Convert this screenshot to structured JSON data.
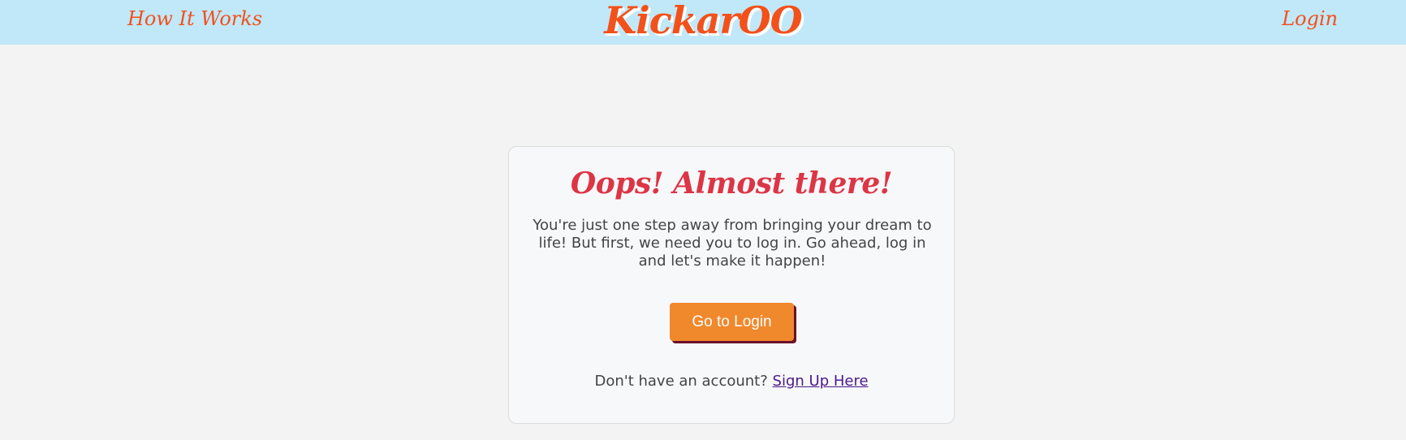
{
  "nav": {
    "how_it_works": "How It Works",
    "brand": "KickarOO",
    "login": "Login"
  },
  "card": {
    "title": "Oops! Almost there!",
    "message": "You're just one step away from bringing your dream to life! But first, we need you to log in. Go ahead, log in and let's make it happen!",
    "button_label": "Go to Login",
    "signup_prompt": "Don't have an account?",
    "signup_link": "Sign Up Here"
  },
  "colors": {
    "navbar_bg": "#c1e8f8",
    "brand_orange": "#f2511b",
    "title_red": "#dc3545",
    "button_orange": "#f0882c",
    "button_shadow": "#6b1028",
    "link_purple": "#4b1a8a",
    "page_bg": "#f3f3f3"
  }
}
